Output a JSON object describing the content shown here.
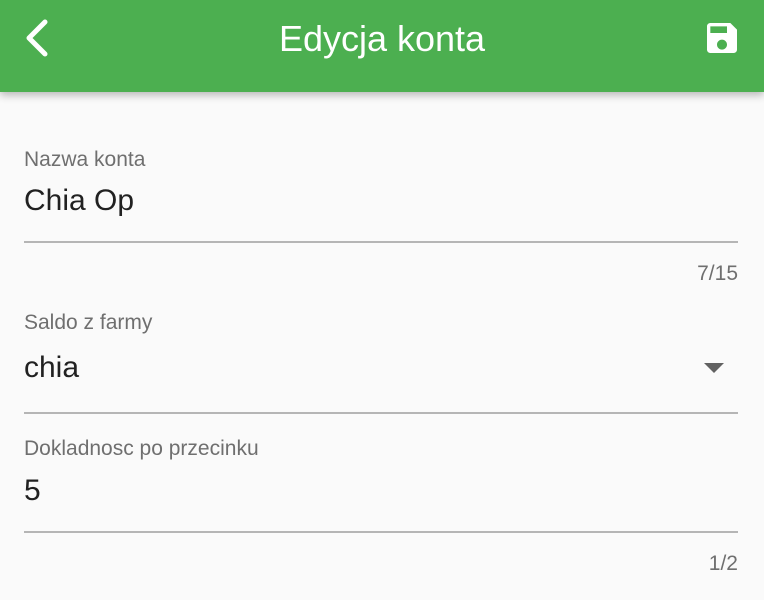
{
  "appbar": {
    "title": "Edycja konta",
    "back_icon": "chevron-left-icon",
    "save_icon": "floppy-disk-icon",
    "color": "#4caf50"
  },
  "form": {
    "account_name": {
      "label": "Nazwa konta",
      "value": "Chia Op",
      "counter": "7/15"
    },
    "farm_balance": {
      "label": "Saldo z farmy",
      "value": "chia",
      "icon": "dropdown-arrow-icon"
    },
    "decimal_precision": {
      "label": "Dokladnosc po przecinku",
      "value": "5",
      "counter": "1/2"
    }
  }
}
